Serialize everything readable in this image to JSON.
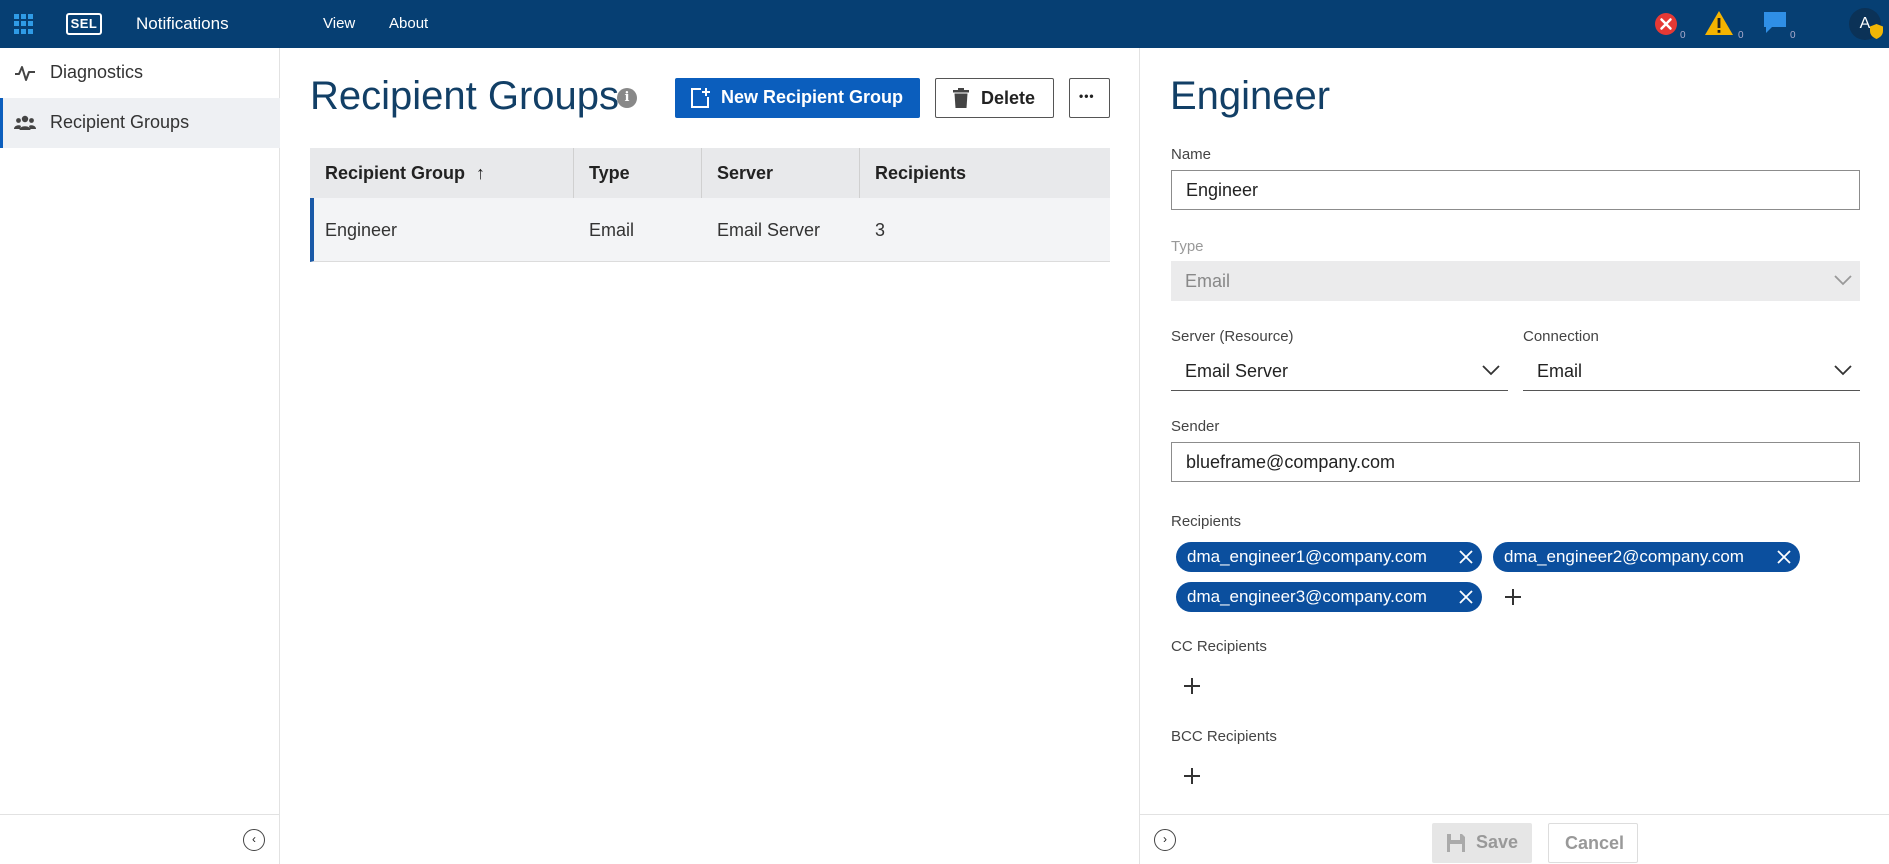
{
  "topbar": {
    "logo": "SEL",
    "app_title": "Notifications",
    "menu": [
      "View",
      "About"
    ],
    "status": {
      "errors": "0",
      "warnings": "0",
      "messages": "0"
    },
    "avatar_initial": "A"
  },
  "sidebar": {
    "items": [
      {
        "label": "Diagnostics",
        "icon": "pulse-icon"
      },
      {
        "label": "Recipient Groups",
        "icon": "people-icon"
      }
    ]
  },
  "main": {
    "title": "Recipient Groups",
    "new_button": "New Recipient Group",
    "delete_button": "Delete",
    "more_button": "•••",
    "columns": [
      "Recipient Group",
      "Type",
      "Server",
      "Recipients"
    ],
    "sort_indicator": "↑",
    "rows": [
      {
        "group": "Engineer",
        "type": "Email",
        "server": "Email Server",
        "recipients": "3"
      }
    ]
  },
  "detail": {
    "title": "Engineer",
    "name_label": "Name",
    "name_value": "Engineer",
    "type_label": "Type",
    "type_value": "Email",
    "server_label": "Server (Resource)",
    "server_value": "Email Server",
    "connection_label": "Connection",
    "connection_value": "Email",
    "sender_label": "Sender",
    "sender_value": "blueframe@company.com",
    "recipients_label": "Recipients",
    "recipients": [
      "dma_engineer1@company.com",
      "dma_engineer2@company.com",
      "dma_engineer3@company.com"
    ],
    "cc_label": "CC Recipients",
    "bcc_label": "BCC Recipients",
    "save_button": "Save",
    "cancel_button": "Cancel"
  },
  "colors": {
    "topbar": "#063f73",
    "accent": "#0b5ebd",
    "chip": "#0b4f9e",
    "title": "#123f66"
  }
}
